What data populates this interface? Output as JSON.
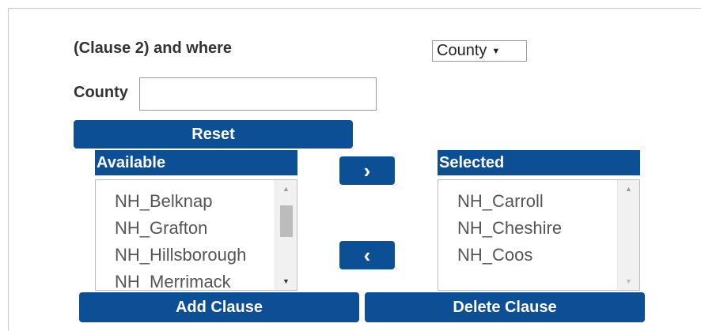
{
  "clause": {
    "label": "(Clause 2) and where"
  },
  "field_select": {
    "value": "County",
    "arrow": "▼"
  },
  "county": {
    "label": "County",
    "value": "",
    "placeholder": ""
  },
  "buttons": {
    "reset": "Reset",
    "move_right": "›",
    "move_left": "‹",
    "add_clause": "Add Clause",
    "delete_clause": "Delete Clause"
  },
  "available": {
    "header": "Available",
    "items": [
      "NH_Belknap",
      "NH_Grafton",
      "NH_Hillsborough",
      "NH_Merrimack"
    ]
  },
  "selected": {
    "header": "Selected",
    "items": [
      "NH_Carroll",
      "NH_Cheshire",
      "NH_Coos"
    ]
  },
  "scroll": {
    "up": "▲",
    "down": "▼"
  },
  "colors": {
    "button_bg": "#0d4f94",
    "button_text": "#ffffff",
    "text": "#333333"
  }
}
